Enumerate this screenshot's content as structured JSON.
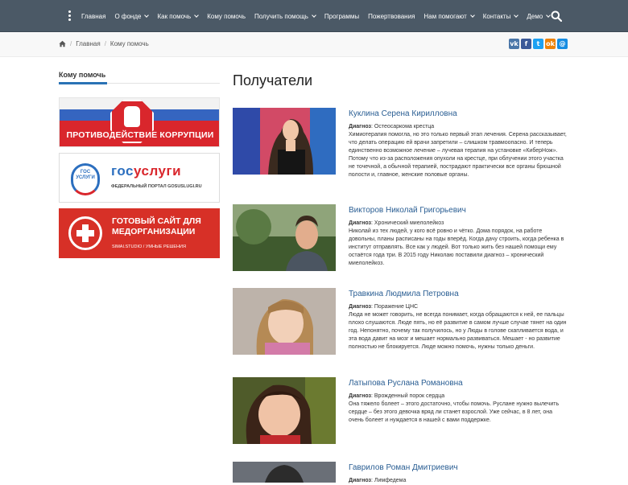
{
  "nav": {
    "items": [
      {
        "label": "Главная",
        "caret": false
      },
      {
        "label": "О фонде",
        "caret": true
      },
      {
        "label": "Как помочь",
        "caret": true
      },
      {
        "label": "Кому помочь",
        "caret": false
      },
      {
        "label": "Получить помощь",
        "caret": true
      },
      {
        "label": "Программы",
        "caret": false
      },
      {
        "label": "Пожертвования",
        "caret": false
      },
      {
        "label": "Нам помогают",
        "caret": true
      },
      {
        "label": "Контакты",
        "caret": true
      },
      {
        "label": "Демо",
        "caret": true
      }
    ],
    "search_icon": "search-icon"
  },
  "breadcrumb": {
    "home_icon": "home-icon",
    "items": [
      "Главная",
      "Кому помочь"
    ]
  },
  "share": [
    {
      "icon": "vk-icon",
      "glyph": "vk",
      "color": "#4a76a8"
    },
    {
      "icon": "facebook-icon",
      "glyph": "f",
      "color": "#3b5998"
    },
    {
      "icon": "twitter-icon",
      "glyph": "t",
      "color": "#1da1f2"
    },
    {
      "icon": "odnoklassniki-icon",
      "glyph": "ok",
      "color": "#ee8208"
    },
    {
      "icon": "moimir-icon",
      "glyph": "@",
      "color": "#168de2"
    }
  ],
  "sidebar": {
    "title": "Кому помочь",
    "banners": {
      "corruption": {
        "text": "ПРОТИВОДЕЙСТВИЕ КОРРУПЦИИ"
      },
      "gosuslugi": {
        "badge": "ГОС УСЛУГИ",
        "title_blue": "гос",
        "title_red": "услуги",
        "subtitle": "ФЕДЕРАЛЬНЫЙ ПОРТАЛ GOSUSLUGI.RU"
      },
      "medsite": {
        "line1": "ГОТОВЫЙ САЙТ ДЛЯ",
        "line2": "МЕДОРГАНИЗАЦИИ",
        "line3": "SIMAI.STUDIO / УМНЫЕ РЕШЕНИЯ"
      }
    }
  },
  "main": {
    "title": "Получатели",
    "diagnosis_label": "Диагноз",
    "recipients": [
      {
        "name": "Куклина Серена Кирилловна",
        "diagnosis": ": Остеосаркома крестца",
        "text": "Химиотерапия помогла, но это только первый этап лечения. Серена рассказывает, что делать операцию ей врачи запретили – слишком травмоопасно. И теперь единственно возможное лечение – лучевая терапия на установке «КиберНож». Потому что из-за расположения опухоли на крестце, при облучении этого участка не точечной, а обычной терапией, пострадают практически все органы брюшной полости и, главное, женские половые органы."
      },
      {
        "name": "Викторов Николай Григорьевич",
        "diagnosis": ": Хронический миелолейкоз",
        "text": "Николай из тех людей, у кого всё ровно и чётко. Дома порядок, на работе довольны, планы расписаны на годы вперёд. Когда дачу строить, когда ребенка в институт отправлять. Все как у людей. Вот только жить без нашей помощи ему остаётся года три. В 2015 году Николаю поставили диагноз – хронический миелолейкоз."
      },
      {
        "name": "Травкина Людмила Петровна",
        "diagnosis": ": Поражение ЦНС",
        "text": "Люда не может говорить, не всегда понимает, когда обращаются к ней, ее пальцы плохо слушаются. Люде пять, но её развитие в самом лучше случае тянет на один год. Непонятно, почему так получилось, но у Люды в голове скапливается вода, и эта вода давит на мозг и мешает нормально развиваться. Мешает - но развитие полностью не блокируется. Люде можно помочь, нужны только деньги."
      },
      {
        "name": "Латыпова Руслана Романовна",
        "diagnosis": ": Врожденный порок сердца",
        "text": "Она тяжело болеет – этого достаточно, чтобы помочь. Руслане нужно вылечить сердце – без этого девочка вряд ли станет взрослой. Уже сейчас, в 8 лет, она очень болеет и нуждается в нашей с вами поддержке."
      },
      {
        "name": "Гаврилов Роман Дмитриевич",
        "diagnosis": ": Лимфедема",
        "text": ""
      }
    ]
  }
}
